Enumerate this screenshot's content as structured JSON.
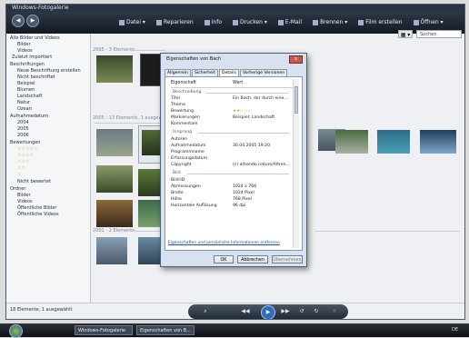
{
  "window": {
    "title": "Windows-Fotogalerie"
  },
  "toolbar": {
    "items": [
      {
        "label": "Datei ▾",
        "icon": "file-icon"
      },
      {
        "label": "Reparieren",
        "icon": "repair-icon"
      },
      {
        "label": "Info",
        "icon": "info-icon"
      },
      {
        "label": "Drucken ▾",
        "icon": "printer-icon"
      },
      {
        "label": "E-Mail",
        "icon": "mail-icon"
      },
      {
        "label": "Brennen ▾",
        "icon": "burn-icon"
      },
      {
        "label": "Film erstellen",
        "icon": "movie-icon"
      },
      {
        "label": "Öffnen ▾",
        "icon": "open-icon"
      }
    ],
    "back": "◀",
    "forward": "▶"
  },
  "search": {
    "placeholder": "Suchen"
  },
  "sidebar": {
    "items": [
      "Alle Bilder und Videos",
      "Bilder",
      "Videos",
      "Zuletzt importiert",
      "Beschriftungen",
      "Neue Beschriftung erstellen",
      "Nicht beschriftet",
      "Beispiel",
      "Blumen",
      "Landschaft",
      "Natur",
      "Ozean",
      "Aufnahmedatum",
      "2004",
      "2005",
      "2006",
      "Bewertungen",
      "Nicht bewertet",
      "Ordner",
      "Bilder",
      "Videos",
      "Öffentliche Bilder",
      "Öffentliche Videos"
    ]
  },
  "sections": {
    "s1": "2005 - 3 Elemente",
    "s2": "2005 - 13 Elemente, 1 ausgewählt",
    "s3": "2001 - 2 Elemente"
  },
  "status": {
    "text": "18 Elemente, 1 ausgewählt"
  },
  "taskbar": {
    "buttons": [
      "Windows-Fotogalerie",
      "Eigenschaften von B..."
    ],
    "tray": "DE"
  },
  "dialog": {
    "title": "Eigenschaften von Bach",
    "close": "x",
    "tabs": [
      "Allgemein",
      "Sicherheit",
      "Details",
      "Vorherige Versionen"
    ],
    "header": {
      "name": "Eigenschaft",
      "value": "Wert"
    },
    "groups": {
      "beschreibung": "Beschreibung",
      "ursprung": "Ursprung",
      "bild": "Bild"
    },
    "rows": [
      {
        "name": "Titel",
        "value": "Ein Bach, der durch eine..."
      },
      {
        "name": "Thema",
        "value": ""
      },
      {
        "name": "Bewertung",
        "value": "★★☆☆☆"
      },
      {
        "name": "Markierungen",
        "value": "Beispiel; Landschaft"
      },
      {
        "name": "Kommentare",
        "value": ""
      },
      {
        "name": "Autoren",
        "value": ""
      },
      {
        "name": "Aufnahmedatum",
        "value": "30.04.2005 19:20"
      },
      {
        "name": "Programmname",
        "value": ""
      },
      {
        "name": "Erfassungsdatum",
        "value": ""
      },
      {
        "name": "Copyright",
        "value": "(c) altrendo nature/Altren..."
      },
      {
        "name": "Bild-ID",
        "value": ""
      },
      {
        "name": "Abmessungen",
        "value": "1024 x 768"
      },
      {
        "name": "Breite",
        "value": "1024 Pixel"
      },
      {
        "name": "Höhe",
        "value": "768 Pixel"
      },
      {
        "name": "Horizontale Auflösung",
        "value": "96 dpi"
      }
    ],
    "link": "Eigenschaften und persönliche Informationen entfernen",
    "buttons": {
      "ok": "OK",
      "cancel": "Abbrechen",
      "apply": "Übernehmen"
    }
  },
  "controls": {
    "zoom": "⌕",
    "prev": "◀◀",
    "play": "▶",
    "next": "▶▶",
    "rotate_left": "↺",
    "rotate_right": "↻",
    "delete": "✕"
  }
}
